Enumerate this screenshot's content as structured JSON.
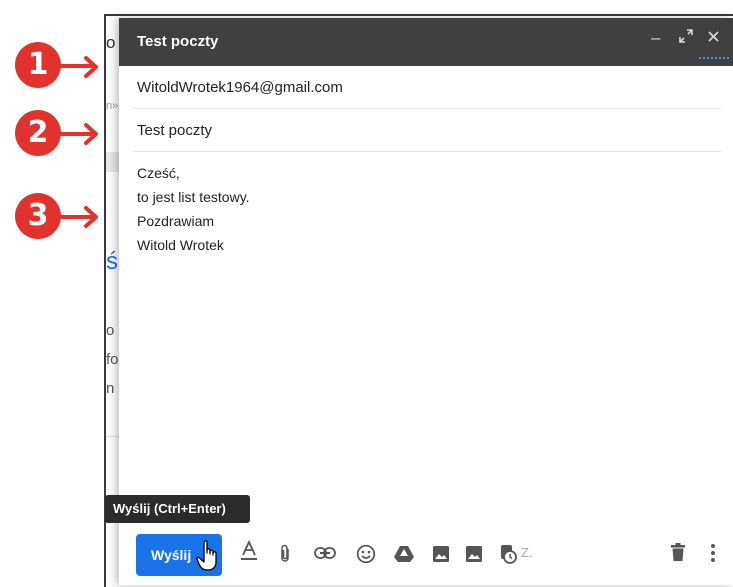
{
  "compose": {
    "title": "Test poczty",
    "to": "WitoldWrotek1964@gmail.com",
    "subject": "Test poczty",
    "body_lines": [
      "Cześć,",
      "to jest list testowy.",
      "Pozdrawiam",
      "Witold Wrotek"
    ]
  },
  "toolbar": {
    "send_label": "Wyślij",
    "send_tooltip": "Wyślij (Ctrl+Enter)",
    "more_label": "Z."
  },
  "callouts": [
    "1",
    "2",
    "3"
  ],
  "background_fragments": [
    "o",
    "n»",
    "ś",
    "o",
    "fo",
    "n"
  ],
  "colors": {
    "titlebar": "#404040",
    "send_button": "#1a73e8",
    "callout": "#e2322d",
    "tooltip": "#2b2b2b"
  },
  "icons": [
    "minimize-icon",
    "expand-icon",
    "close-icon",
    "text-format-icon",
    "attach-icon",
    "link-icon",
    "emoji-icon",
    "drive-icon",
    "photo-icon",
    "confidential-icon",
    "trash-icon",
    "more-options-icon",
    "hand-cursor-icon",
    "arrow-right-icon"
  ]
}
